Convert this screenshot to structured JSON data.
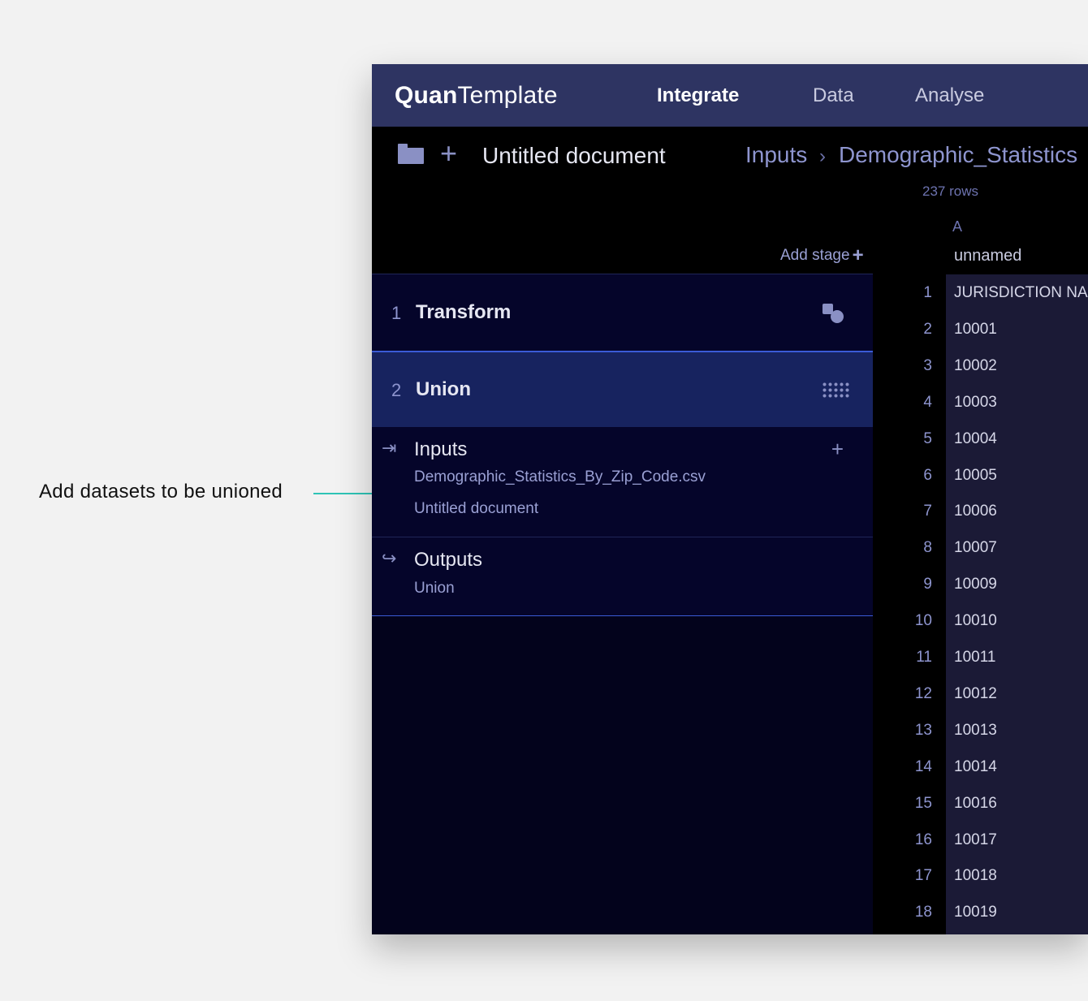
{
  "annotation": {
    "text": "Add datasets to be unioned"
  },
  "header": {
    "logo_bold": "Quan",
    "logo_light": "Template",
    "nav": [
      "Integrate",
      "Data",
      "Analyse"
    ],
    "active_nav": "Integrate"
  },
  "document": {
    "title": "Untitled document",
    "breadcrumb": [
      "Inputs",
      "Demographic_Statistics"
    ]
  },
  "toolbar": {
    "add_stage": "Add stage"
  },
  "stages": [
    {
      "number": "1",
      "name": "Transform",
      "icon": "transform-icon"
    },
    {
      "number": "2",
      "name": "Union",
      "icon": "grid-icon",
      "selected": true
    }
  ],
  "inputs": {
    "title": "Inputs",
    "items": [
      "Demographic_Statistics_By_Zip_Code.csv",
      "Untitled document"
    ]
  },
  "outputs": {
    "title": "Outputs",
    "items": [
      "Union"
    ]
  },
  "table": {
    "row_count": "237 rows",
    "column_letter": "A",
    "column_name": "unnamed",
    "rows": [
      {
        "n": "1",
        "v": "JURISDICTION NAME"
      },
      {
        "n": "2",
        "v": "10001"
      },
      {
        "n": "3",
        "v": "10002"
      },
      {
        "n": "4",
        "v": "10003"
      },
      {
        "n": "5",
        "v": "10004"
      },
      {
        "n": "6",
        "v": "10005"
      },
      {
        "n": "7",
        "v": "10006"
      },
      {
        "n": "8",
        "v": "10007"
      },
      {
        "n": "9",
        "v": "10009"
      },
      {
        "n": "10",
        "v": "10010"
      },
      {
        "n": "11",
        "v": "10011"
      },
      {
        "n": "12",
        "v": "10012"
      },
      {
        "n": "13",
        "v": "10013"
      },
      {
        "n": "14",
        "v": "10014"
      },
      {
        "n": "15",
        "v": "10016"
      },
      {
        "n": "16",
        "v": "10017"
      },
      {
        "n": "17",
        "v": "10018"
      },
      {
        "n": "18",
        "v": "10019"
      }
    ]
  }
}
